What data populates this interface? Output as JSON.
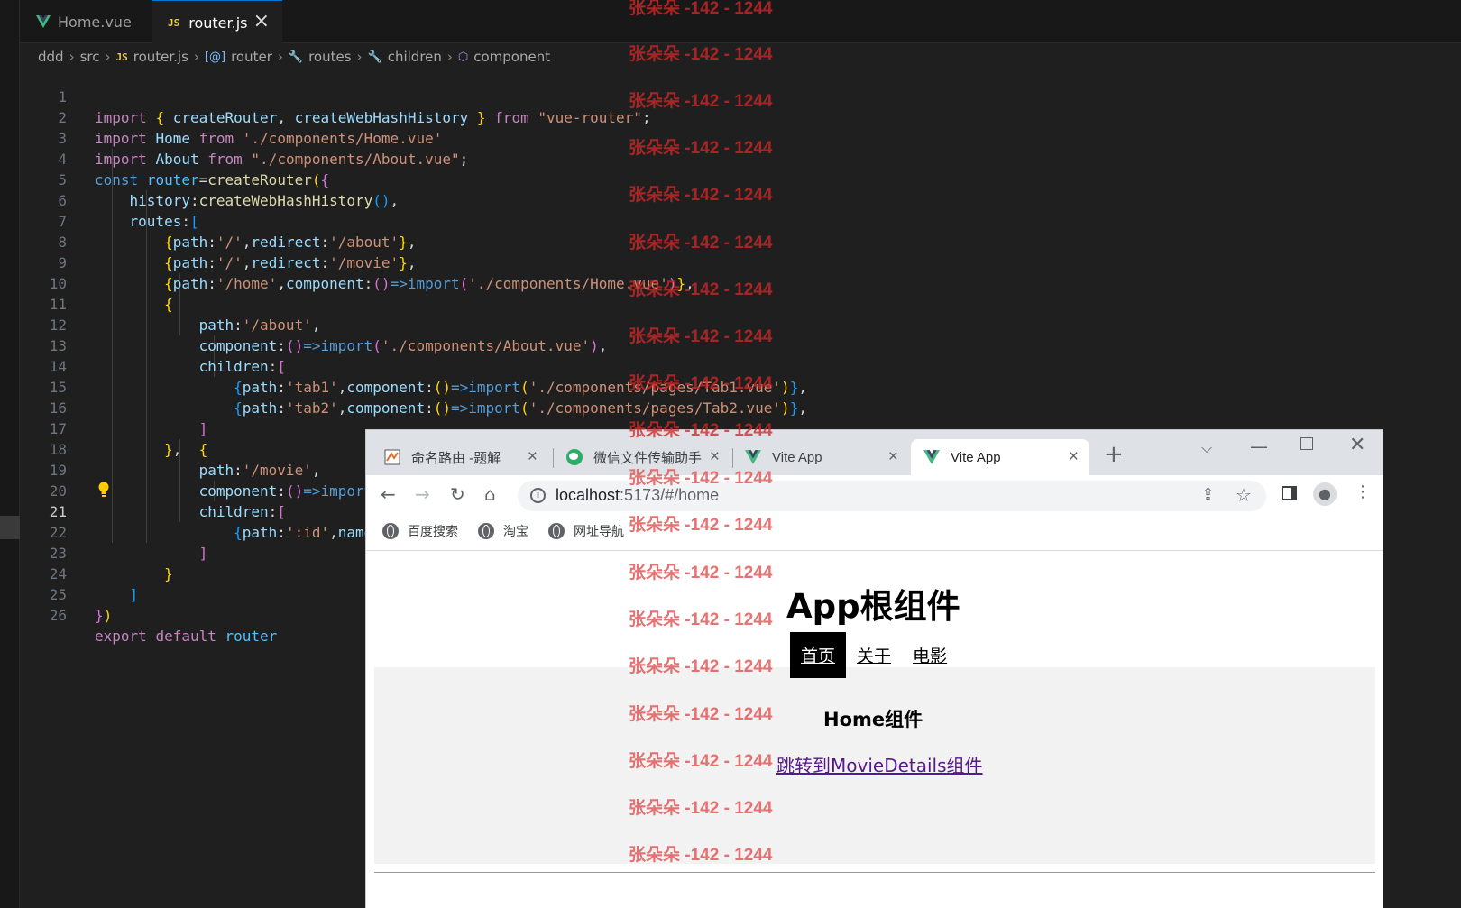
{
  "editor": {
    "tabs": [
      {
        "label": "Home.vue",
        "icon": "vue-icon",
        "active": false
      },
      {
        "label": "router.js",
        "icon": "js-icon",
        "active": true
      }
    ],
    "breadcrumb": [
      "ddd",
      "src",
      "router.js",
      "router",
      "routes",
      "children",
      "component"
    ],
    "current_line": 21,
    "line_numbers": [
      "1",
      "2",
      "3",
      "4",
      "5",
      "6",
      "7",
      "8",
      "9",
      "10",
      "11",
      "12",
      "13",
      "14",
      "15",
      "16",
      "17",
      "18",
      "19",
      "20",
      "21",
      "22",
      "23",
      "24",
      "25",
      "26"
    ],
    "code": {
      "l1": {
        "kw1": "import",
        "b1": "{",
        "id1": "createRouter",
        "c": ",",
        "id2": "createWebHashHistory",
        "b2": "}",
        "kw2": "from",
        "str": "\"vue-router\"",
        "end": ";"
      },
      "l2": {
        "kw1": "import",
        "id": "Home",
        "kw2": "from",
        "str": "'./components/Home.vue'"
      },
      "l3": {
        "kw1": "import",
        "id": "About",
        "kw2": "from",
        "str": "\"./components/About.vue\"",
        "end": ";"
      },
      "l4": {
        "kw": "const",
        "id": "router",
        "op": "=",
        "fn": "createRouter",
        "b1": "(",
        "b2": "{"
      },
      "l5": {
        "key": "history",
        "colon": ":",
        "fn": "createWebHashHistory",
        "b": "()",
        "end": ","
      },
      "l6": {
        "key": "routes",
        "colon": ":",
        "b": "["
      },
      "l7": {
        "b1": "{",
        "k1": "path",
        "s1": "'/'",
        "k2": "redirect",
        "s2": "'/about'",
        "b2": "}",
        "end": ","
      },
      "l8": {
        "b1": "{",
        "k1": "path",
        "s1": "'/'",
        "k2": "redirect",
        "s2": "'/movie'",
        "b2": "}",
        "end": ","
      },
      "l9": {
        "b1": "{",
        "k1": "path",
        "s1": "'/home'",
        "k2": "component",
        "arrow_open": "()",
        "arrow": "=>",
        "kw": "import",
        "p1": "(",
        "s2": "'./components/Home.vue'",
        "p2": ")",
        "b2": "}",
        "end": ","
      },
      "l10": {
        "b": "{"
      },
      "l11": {
        "key": "path",
        "str": "'/about'",
        "end": ","
      },
      "l12": {
        "key": "component",
        "paren": "()",
        "arrow": "=>",
        "kw": "import",
        "p1": "(",
        "str": "'./components/About.vue'",
        "p2": ")",
        "end": ","
      },
      "l13": {
        "key": "children",
        "b": "["
      },
      "l14": {
        "b1": "{",
        "k1": "path",
        "s1": "'tab1'",
        "k2": "component",
        "paren": "()",
        "arrow": "=>",
        "kw": "import",
        "p1": "(",
        "s2": "'./components/pages/Tab1.vue'",
        "p2": ")",
        "b2": "}",
        "end": ","
      },
      "l15": {
        "b1": "{",
        "k1": "path",
        "s1": "'tab2'",
        "k2": "component",
        "paren": "()",
        "arrow": "=>",
        "kw": "import",
        "p1": "(",
        "s2": "'./components/pages/Tab2.vue'",
        "p2": ")",
        "b2": "}",
        "end": ","
      },
      "l16": {
        "b": "]"
      },
      "l17": {
        "b1": "}",
        "mid": ",  ",
        "b2": "{"
      },
      "l18": {
        "key": "path",
        "str": "'/movie'",
        "end": ","
      },
      "l19": {
        "key": "component",
        "paren": "()",
        "arrow": "=>",
        "kw": "import"
      },
      "l20": {
        "key": "children",
        "b": "["
      },
      "l21": {
        "b1": "{",
        "k1": "path",
        "s1": "':id'",
        "c": ",",
        "k2": "name"
      },
      "l22": {
        "b": "]"
      },
      "l23": {
        "b": "}"
      },
      "l24": {
        "b": "]"
      },
      "l25": {
        "b1": "}",
        "b2": ")"
      },
      "l26": {
        "kw1": "export",
        "kw2": "default",
        "id": "router"
      }
    }
  },
  "browser": {
    "tabs": [
      {
        "title": "命名路由 -题解",
        "favicon": "jupyter-icon"
      },
      {
        "title": "微信文件传输助手",
        "favicon": "wechat-icon"
      },
      {
        "title": "Vite App",
        "favicon": "vue-icon"
      },
      {
        "title": "Vite App",
        "favicon": "vue-icon",
        "active": true
      }
    ],
    "url": {
      "host": "localhost",
      "rest": ":5173/#/home"
    },
    "bookmarks": [
      "百度搜索",
      "淘宝",
      "网址导航"
    ],
    "page": {
      "title": "App根组件",
      "nav": [
        {
          "label": "首页",
          "active": true
        },
        {
          "label": "关于",
          "active": false
        },
        {
          "label": "电影",
          "active": false
        }
      ],
      "home_title": "Home组件",
      "home_link": "跳转到MovieDetails组件"
    }
  },
  "watermark": "张朵朵 -142 - 1244",
  "colors": {
    "editor_bg": "#1f1f1f",
    "keyword": "#c586c0",
    "storage": "#569cd6",
    "function": "#dcdcaa",
    "variable": "#9cdcfe",
    "string": "#ce9178",
    "bracket_gold": "#ffd700",
    "bracket_orchid": "#da70d6",
    "bracket_blue": "#179fff",
    "watermark": "#d02828",
    "nav_active_bg": "#000000",
    "link_visited": "#551a8b"
  }
}
